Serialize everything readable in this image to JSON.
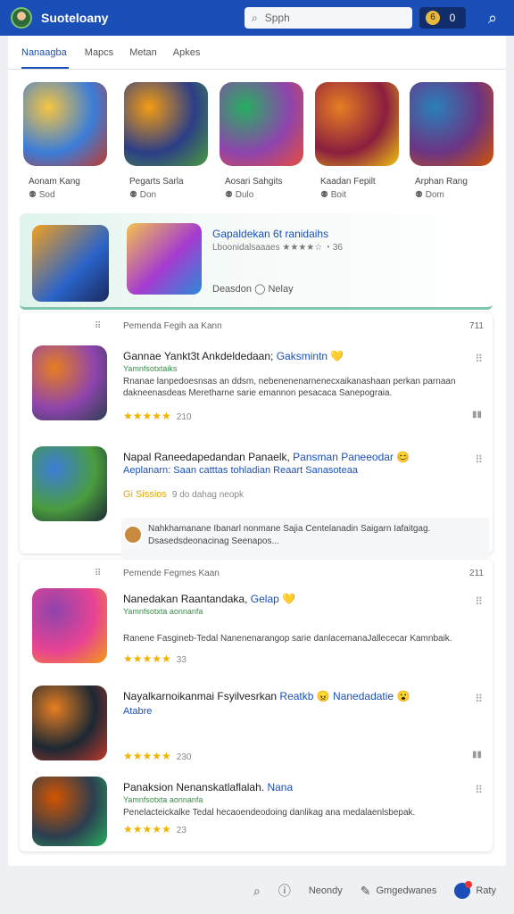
{
  "header": {
    "title": "Suoteloany",
    "search_placeholder": "Spph",
    "pill_a": "6",
    "pill_b": "0",
    "search_icon": "search-icon"
  },
  "tabs": [
    "Nanaagba",
    "Mapcs",
    "Metan",
    "Apkes"
  ],
  "featured": [
    {
      "name": "Aonam Kang",
      "meta": "Sod",
      "colors": [
        "#f5c542",
        "#3b7dd8",
        "#c0392b"
      ]
    },
    {
      "name": "Pegarts Sarla",
      "meta": "Don",
      "colors": [
        "#f39c12",
        "#2c3e87",
        "#4a9c3f"
      ]
    },
    {
      "name": "Aosari Sahgits",
      "meta": "Dulo",
      "colors": [
        "#27ae60",
        "#8e44ad",
        "#e74c3c"
      ]
    },
    {
      "name": "Kaadan Fepilt",
      "meta": "Boit",
      "colors": [
        "#e67e22",
        "#8b1e3f",
        "#f1c40f"
      ]
    },
    {
      "name": "Arphan Rang",
      "meta": "Dom",
      "colors": [
        "#2980b9",
        "#6c3483",
        "#d35400"
      ]
    }
  ],
  "spotlight": {
    "title": "Gapaldekan 6t ranidaihs",
    "subtitle": "Lboonidalsaaaes",
    "rating": "36",
    "footer": "Deasdon",
    "footer_tag": "Nelay"
  },
  "section1": {
    "title": "Pemenda Fegih aa Kann",
    "count": "711",
    "rows": [
      {
        "title": "Gannae Yankt3t Ankdeldedaan;",
        "highlight": "Gaksmintn",
        "sub": "Yamnfsotxtaiks",
        "desc": "Rnanae lanpedoesnsas an ddsm, nebenenenarnenecxaikanashaan perkan parnaan dakneenasdeas Meretharne sarie emannon pesacaca Sanepograia.",
        "rating": "210",
        "colors": [
          "#e67e22",
          "#8e44ad",
          "#2c3e50"
        ]
      },
      {
        "title": "Napal Raneedapedandan Panaelk,",
        "highlight": "Pansman Paneeodar",
        "sub": "Aeplanarn: Saan catttas tohladian Reaart Sanasoteaa",
        "desc": "",
        "rating": "",
        "tag": "Gi Sissios",
        "tag2": "9 do dahag neopk",
        "colors": [
          "#3b7dd8",
          "#4a9c3f",
          "#1c2833"
        ]
      }
    ],
    "review": "Nahkhamanane Ibanarl nonmane Sajia Centelanadin Saigarn Iafaitgag. Dsasedsdeonacinag Seenapos..."
  },
  "section2": {
    "title": "Pemende Fegmes Kaan",
    "count": "211",
    "rows": [
      {
        "title": "Nanedakan Raantandaka,",
        "highlight": "Gelap",
        "sub": "Yamnfsotxta aonnanfa",
        "desc": "Ranene Fasgineb-Tedal Nanenenarangop sarie danlacemanaJallececar Kamnbaik.",
        "rating": "33",
        "colors": [
          "#8e44ad",
          "#e84393",
          "#f39c12"
        ]
      },
      {
        "title": "Nayalkarnoikanmai Fsyilvesrkan",
        "highlight": "Reatkb",
        "sub": "Atabre",
        "desc": "",
        "rating": "230",
        "tag2": "Nanedadatie",
        "colors": [
          "#e67e22",
          "#1c2833",
          "#c0392b"
        ]
      },
      {
        "title": "Panaksion Nenanskatlaflalah.",
        "highlight": "Nana",
        "sub": "Yamnfsotxta aonnanfa",
        "desc": "Penelacteickalke Tedal hecaoendeodoing danlikag ana medalaenlsbepak.",
        "rating": "23",
        "colors": [
          "#d35400",
          "#2c3e50",
          "#27ae60"
        ]
      }
    ]
  },
  "bottom_nav": [
    {
      "icon": "search-icon",
      "label": ""
    },
    {
      "icon": "info-icon",
      "label": ""
    },
    {
      "icon": "",
      "label": "Neondy"
    },
    {
      "icon": "pen-icon",
      "label": "Gmgedwanes"
    },
    {
      "icon": "profile-icon",
      "label": "Raty"
    }
  ]
}
